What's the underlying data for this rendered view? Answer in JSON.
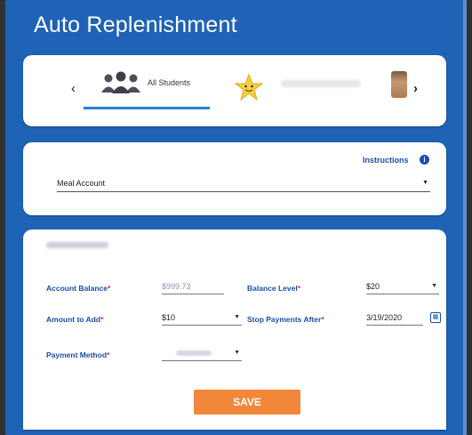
{
  "header": {
    "title": "Auto Replenishment"
  },
  "students": {
    "prev_icon": "‹",
    "next_icon": "›",
    "all_label": "All Students"
  },
  "meal": {
    "instructions_label": "Instructions",
    "info_icon": "i",
    "account_value": "Meal Account"
  },
  "form": {
    "account_balance_label": "Account Balance",
    "account_balance_value": "$999.73",
    "balance_level_label": "Balance Level",
    "balance_level_value": "$20",
    "amount_to_add_label": "Amount to Add",
    "amount_to_add_value": "$10",
    "stop_payments_label": "Stop Payments After",
    "stop_payments_value": "3/19/2020",
    "payment_method_label": "Payment Method",
    "required_mark": "*",
    "save_label": "SAVE"
  },
  "colors": {
    "header_blue": "#1f63b7",
    "label_blue": "#1a4fa8",
    "save_orange": "#f2873a"
  }
}
